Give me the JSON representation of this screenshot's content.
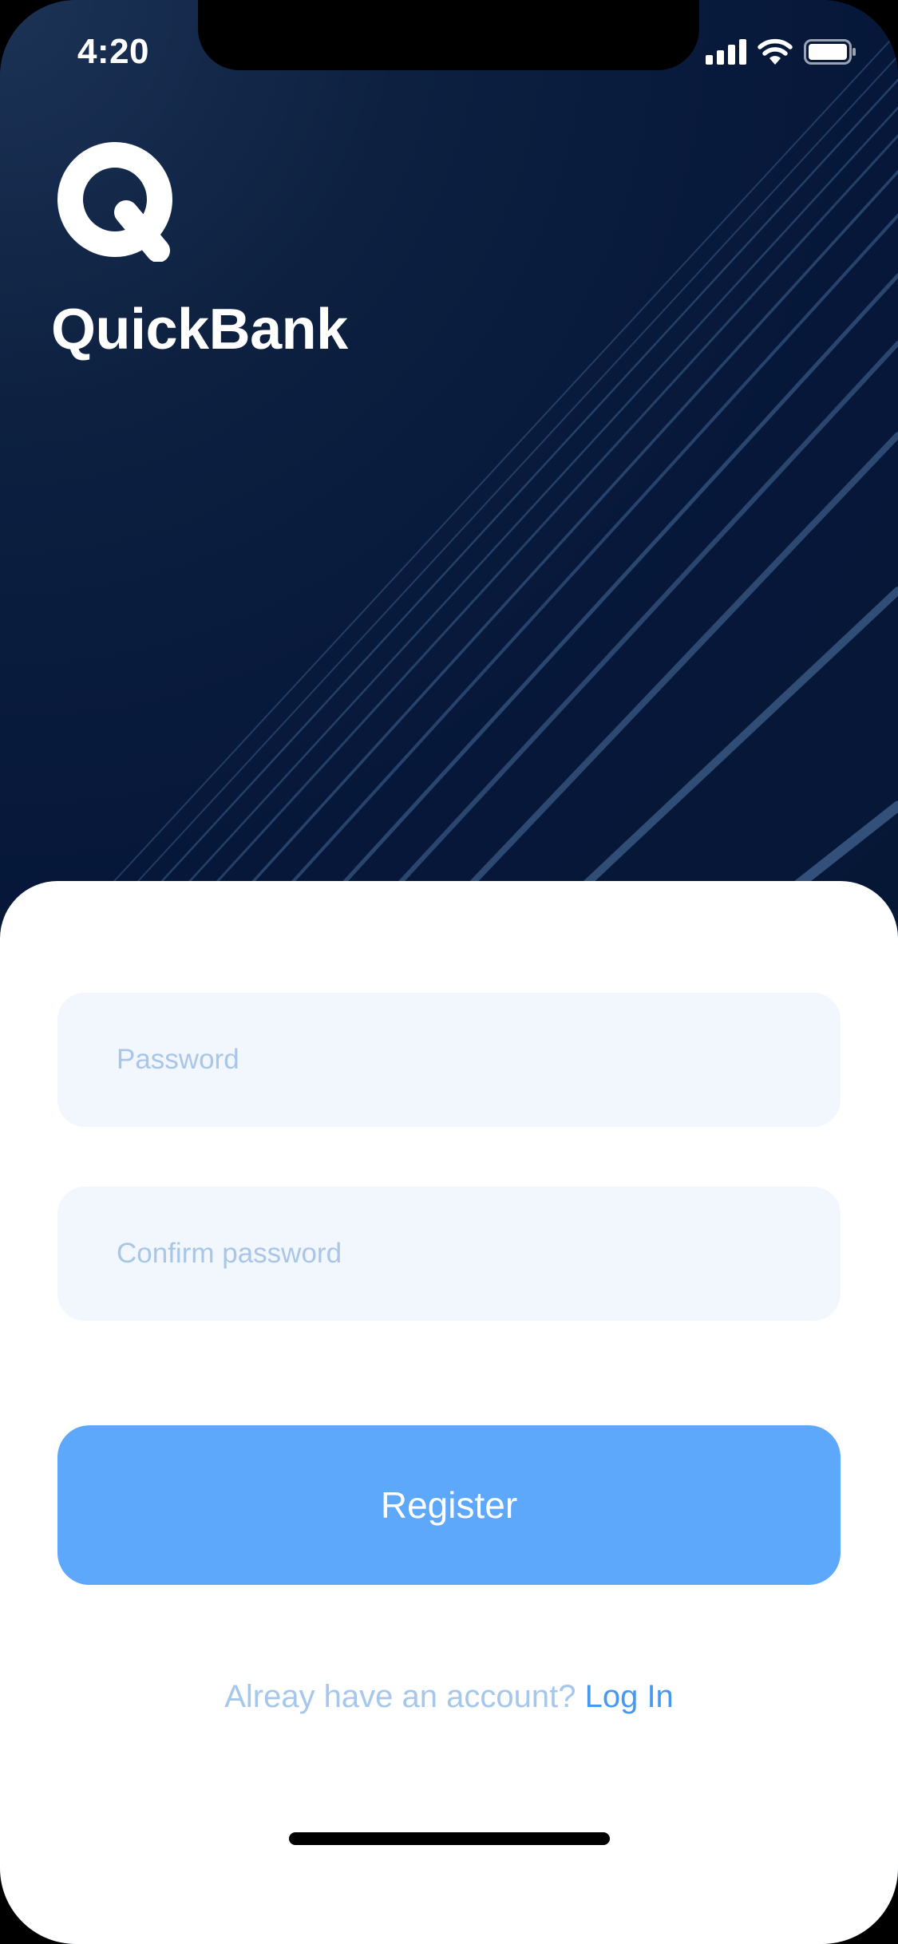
{
  "status_bar": {
    "time": "4:20",
    "icons": [
      "cellular-signal-icon",
      "wifi-icon",
      "battery-icon"
    ]
  },
  "brand": {
    "logo_icon": "q-logo-icon",
    "name": "QuickBank"
  },
  "form": {
    "password_placeholder": "Password",
    "password_value": "",
    "confirm_placeholder": "Confirm password",
    "confirm_value": "",
    "register_label": "Register"
  },
  "footer": {
    "prompt": "Alreay have an account?",
    "login_label": "Log In"
  },
  "colors": {
    "hero_background": "#061736",
    "accent": "#5ea8fc",
    "link": "#4799f0",
    "field_background": "#f1f7fd",
    "placeholder": "#a9c6e6"
  }
}
